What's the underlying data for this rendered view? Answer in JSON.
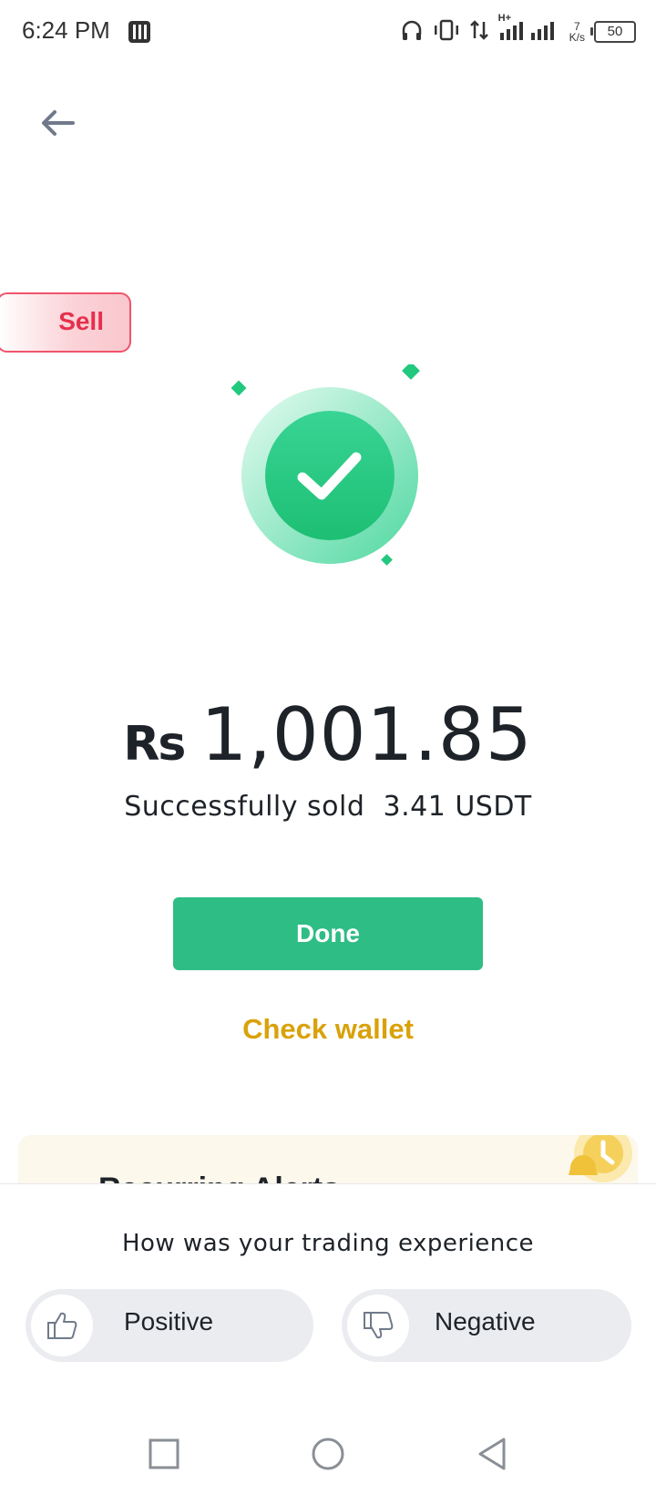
{
  "status_bar": {
    "time": "6:24 PM",
    "net_speed_value": "7",
    "net_speed_unit": "K/s",
    "network_type": "H+",
    "battery": "50",
    "icons": [
      "screen-record-icon",
      "headphones-icon",
      "vibrate-icon",
      "data-transfer-icon",
      "signal-icon",
      "battery-icon"
    ]
  },
  "header": {
    "back_icon": "arrow-left-icon"
  },
  "badge": {
    "label": "Sell"
  },
  "result": {
    "icon": "check-circle-icon",
    "currency": "Rs",
    "amount": "1,001.85",
    "message": "Successfully sold  3.41 USDT"
  },
  "actions": {
    "done_label": "Done",
    "check_wallet_label": "Check wallet"
  },
  "promo": {
    "title": "Recurring Alerts"
  },
  "feedback": {
    "question": "How was your trading experience",
    "positive_label": "Positive",
    "negative_label": "Negative"
  },
  "colors": {
    "accent_green": "#2ebd85",
    "sell_red": "#e5304d",
    "link_gold": "#d9a20b"
  },
  "nav_bar": {
    "buttons": [
      "recents-square-icon",
      "home-circle-icon",
      "back-triangle-icon"
    ]
  }
}
